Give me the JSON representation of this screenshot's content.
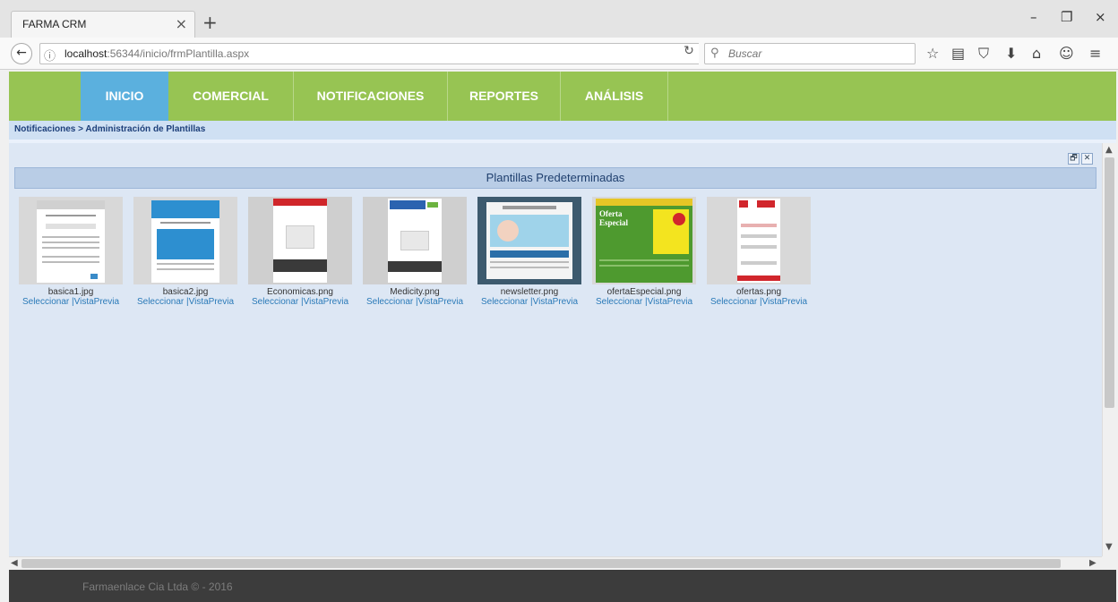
{
  "browser": {
    "tab_title": "FARMA CRM",
    "tab_close": "×",
    "new_tab": "+",
    "url_host": "localhost",
    "url_rest": ":56344/inicio/frmPlantilla.aspx",
    "search_placeholder": "Buscar",
    "window_controls": [
      "–",
      "❐",
      "×"
    ]
  },
  "nav": {
    "items": [
      "INICIO",
      "COMERCIAL",
      "NOTIFICACIONES",
      "REPORTES",
      "ANÁLISIS"
    ],
    "active_index": 0,
    "colors": {
      "bar": "#97c453",
      "active": "#5bb0de"
    }
  },
  "breadcrumb": "Notificaciones > Administración de Plantillas",
  "panel": {
    "section_title": "Plantillas Predeterminadas",
    "tool_restore": "🗗",
    "tool_close": "✕",
    "templates": [
      {
        "filename": "basica1.jpg",
        "select": "Seleccionar",
        "preview": "|VistaPrevia"
      },
      {
        "filename": "basica2.jpg",
        "select": "Seleccionar",
        "preview": "|VistaPrevia"
      },
      {
        "filename": "Economicas.png",
        "select": "Seleccionar",
        "preview": "|VistaPrevia"
      },
      {
        "filename": "Medicity.png",
        "select": "Seleccionar",
        "preview": "|VistaPrevia"
      },
      {
        "filename": "newsletter.png",
        "select": "Seleccionar",
        "preview": "|VistaPrevia"
      },
      {
        "filename": "ofertaEspecial.png",
        "select": "Seleccionar",
        "preview": "|VistaPrevia"
      },
      {
        "filename": "ofertas.png",
        "select": "Seleccionar",
        "preview": "|VistaPrevia"
      }
    ]
  },
  "footer": "Farmaenlace Cia Ltda © - 2016"
}
